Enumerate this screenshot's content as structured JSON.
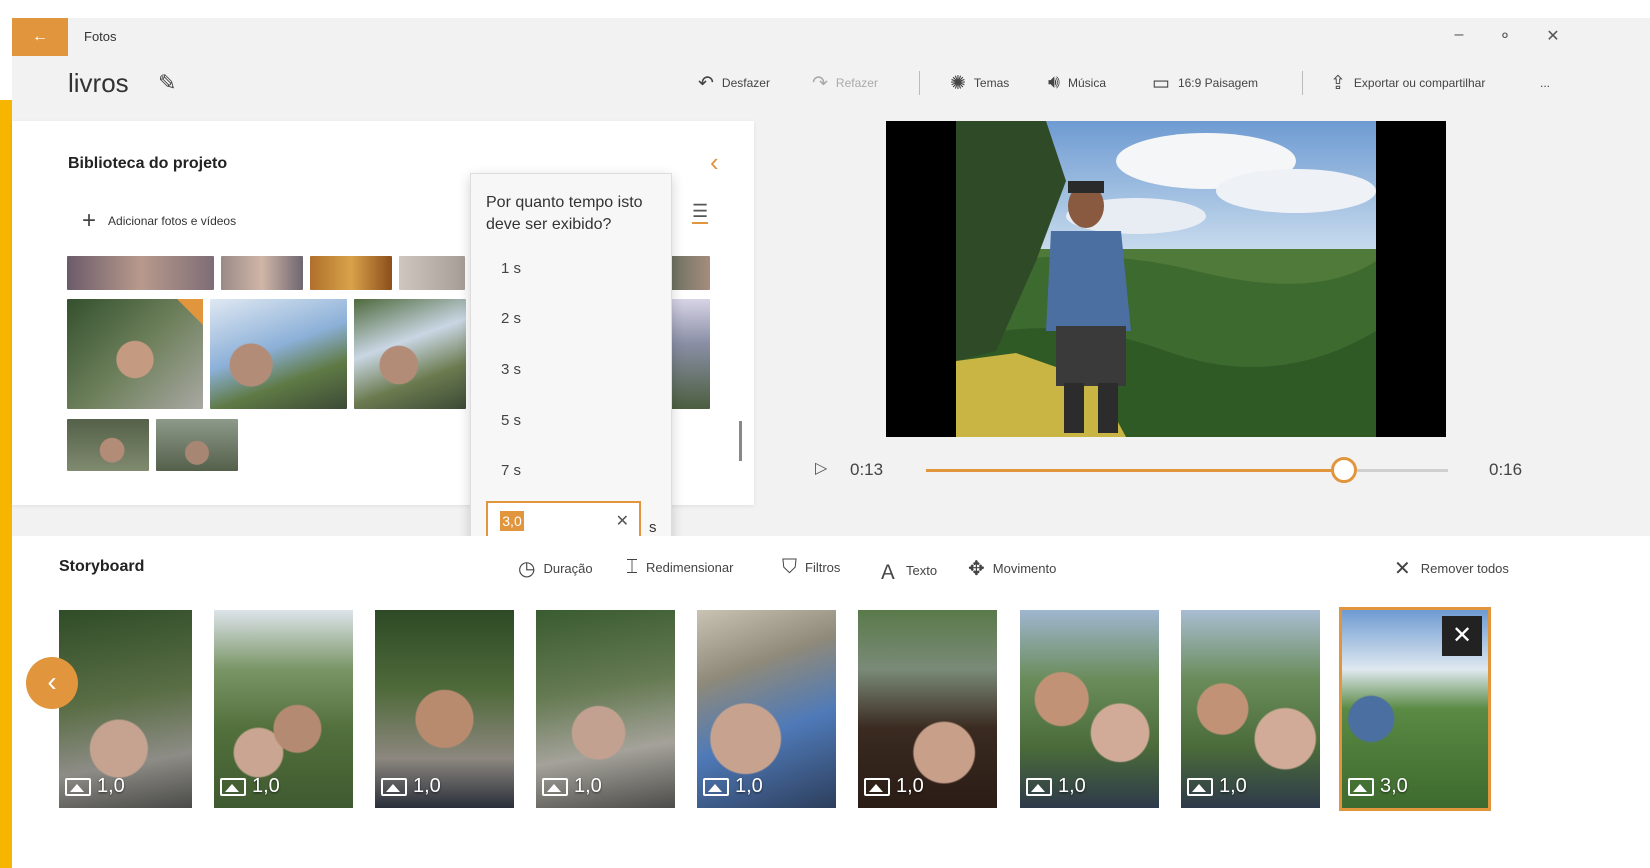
{
  "titlebar": {
    "back_icon": "back-arrow-icon",
    "app_name": "Fotos",
    "minimize": "–",
    "restore": "⚬",
    "close": "✕"
  },
  "header": {
    "project_title": "livros",
    "toolbar": {
      "undo": "Desfazer",
      "redo": "Refazer",
      "themes": "Temas",
      "music": "Música",
      "aspect": "16:9 Paisagem",
      "export": "Exportar ou compartilhar",
      "more": "..."
    }
  },
  "library": {
    "title": "Biblioteca do projeto",
    "add_label": "Adicionar fotos e vídeos",
    "collapse_icon": "chevron-left-icon"
  },
  "duration_flyout": {
    "question": "Por quanto tempo isto deve ser exibido?",
    "options": [
      "1 s",
      "2 s",
      "3 s",
      "5 s",
      "7 s"
    ],
    "custom_value": "3,0",
    "unit": "s"
  },
  "preview": {
    "current_time": "0:13",
    "total_time": "0:16",
    "progress_fraction": 0.8
  },
  "storyboard": {
    "title": "Storyboard",
    "tools": {
      "duration": "Duração",
      "resize": "Redimensionar",
      "filters": "Filtros",
      "text": "Texto",
      "motion": "Movimento",
      "remove_all": "Remover todos"
    },
    "clips": [
      {
        "duration": "1,0"
      },
      {
        "duration": "1,0"
      },
      {
        "duration": "1,0"
      },
      {
        "duration": "1,0"
      },
      {
        "duration": "1,0"
      },
      {
        "duration": "1,0"
      },
      {
        "duration": "1,0"
      },
      {
        "duration": "1,0"
      },
      {
        "duration": "3,0",
        "selected": true
      }
    ]
  },
  "colors": {
    "accent": "#e1953c",
    "edge_bar": "#f6b600"
  }
}
